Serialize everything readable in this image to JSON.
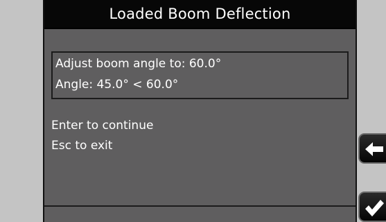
{
  "title": "Loaded Boom Deflection",
  "prompt": {
    "line1": "Adjust boom angle to: 60.0°",
    "line2": "Angle: 45.0° < 60.0°"
  },
  "instructions": {
    "enter": "Enter to continue",
    "esc": "Esc to exit"
  },
  "buttons": {
    "back_icon": "back-arrow-icon",
    "ok_icon": "checkmark-icon"
  },
  "colors": {
    "screen_bg": "#5f5e5f",
    "title_bg": "#070707",
    "bezel": "#c4c4c4",
    "text": "#ffffff"
  }
}
